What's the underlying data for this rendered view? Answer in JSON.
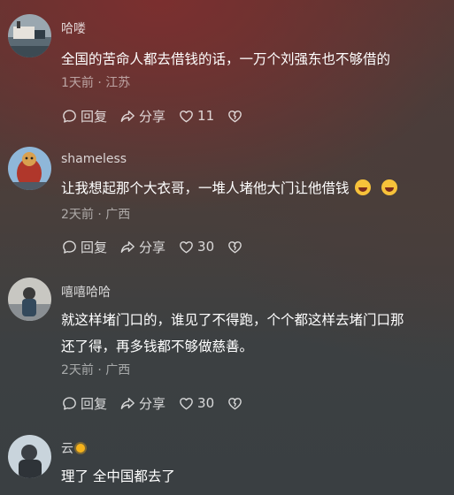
{
  "comments": [
    {
      "username": "哈喽",
      "text": "全国的苦命人都去借钱的话，一万个刘强东也不够借的",
      "meta": "1天前 · 江苏",
      "reply_label": "回复",
      "share_label": "分享",
      "likes": "11"
    },
    {
      "username": "shameless",
      "text": "让我想起那个大衣哥，一堆人堵他大门让他借钱",
      "meta": "2天前 · 广西",
      "reply_label": "回复",
      "share_label": "分享",
      "likes": "30"
    },
    {
      "username": "嘻嘻哈哈",
      "text_line1": "就这样堵门口的，谁见了不得跑，个个都这样去堵门口那",
      "text_line2": "还了得，再多钱都不够做慈善。",
      "meta": "2天前 · 广西",
      "reply_label": "回复",
      "share_label": "分享",
      "likes": "30"
    },
    {
      "username": "云",
      "text": "理了 全中国都去了"
    }
  ],
  "icons": {
    "reply": "comment-bubble-icon",
    "share": "share-arrow-icon",
    "like": "heart-icon",
    "dislike": "broken-heart-icon"
  },
  "colors": {
    "text": "#ffffff",
    "meta": "#9a8f8c"
  }
}
